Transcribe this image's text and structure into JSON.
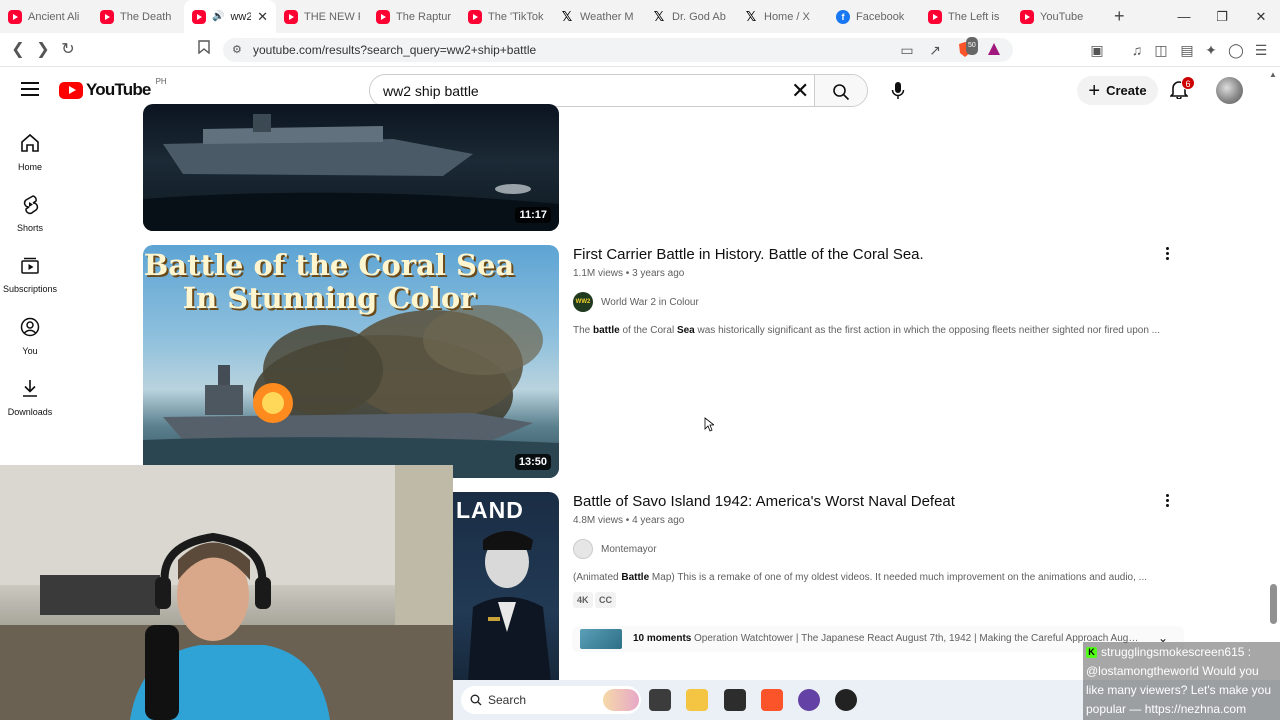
{
  "browser": {
    "tabs": [
      {
        "label": "Ancient Ali",
        "icon": "youtube-icon",
        "active": false
      },
      {
        "label": "The Death",
        "icon": "youtube-icon",
        "active": false
      },
      {
        "label": "ww2",
        "icon": "youtube-icon",
        "active": true
      },
      {
        "label": "THE NEW F",
        "icon": "youtube-icon",
        "active": false
      },
      {
        "label": "The Raptur",
        "icon": "youtube-icon",
        "active": false
      },
      {
        "label": "The 'TikTok",
        "icon": "youtube-icon",
        "active": false
      },
      {
        "label": "Weather M",
        "icon": "x-icon",
        "active": false
      },
      {
        "label": "Dr. God Ab",
        "icon": "x-icon",
        "active": false
      },
      {
        "label": "Home / X",
        "icon": "x-icon",
        "active": false
      },
      {
        "label": "Facebook",
        "icon": "facebook-icon",
        "active": false
      },
      {
        "label": "The Left is",
        "icon": "youtube-icon",
        "active": false
      },
      {
        "label": "YouTube",
        "icon": "youtube-icon",
        "active": false
      }
    ],
    "new_tab": "+",
    "url": "youtube.com/results?search_query=ww2+ship+battle",
    "shield_count": "50"
  },
  "youtube": {
    "logo": "YouTube",
    "country": "PH",
    "search_query": "ww2 ship battle",
    "create_label": "Create",
    "notification_count": "6",
    "nav": [
      {
        "label": "Home",
        "icon": "home-icon"
      },
      {
        "label": "Shorts",
        "icon": "shorts-icon"
      },
      {
        "label": "Subscriptions",
        "icon": "subscriptions-icon"
      },
      {
        "label": "You",
        "icon": "you-icon"
      },
      {
        "label": "Downloads",
        "icon": "downloads-icon"
      }
    ]
  },
  "results": [
    {
      "duration": "11:17"
    },
    {
      "thumb_title_line1": "Battle of the Coral Sea",
      "thumb_title_line2": "In Stunning Color",
      "duration": "13:50",
      "title": "First Carrier Battle in History. Battle of the Coral Sea.",
      "views": "1.1M views",
      "age": "3 years ago",
      "channel": "World War 2 in Colour",
      "channel_avatar_text": "WW2",
      "desc_1": "The ",
      "desc_b1": "battle",
      "desc_2": " of the Coral ",
      "desc_b2": "Sea",
      "desc_3": " was historically significant as the first action in which the opposing fleets neither sighted nor fired upon ..."
    },
    {
      "thumb_title": "LAND",
      "title": "Battle of Savo Island 1942: America's Worst Naval Defeat",
      "views": "4.8M views",
      "age": "4 years ago",
      "channel": "Montemayor",
      "desc_1": "(Animated ",
      "desc_b1": "Battle",
      "desc_2": " Map) This is a remake of one of my oldest videos. It needed much improvement on the animations and audio, ...",
      "badges": [
        "4K",
        "CC"
      ],
      "moments_count": "10 moments",
      "moments_text": "Operation Watchtower | The Japanese React August 7th, 1942 | Making the Careful Approach August ..."
    }
  ],
  "taskbar": {
    "search_label": "Search"
  },
  "chat": {
    "badge": "K",
    "text": "strugglingsmokescreen615 : @lostamongtheworld Would you like many viewers? Let's make you popular — https://nezhna.com"
  },
  "colors": {
    "youtube_red": "#ff0000",
    "notification_badge": "#cc0000",
    "kick_green": "#53fc18"
  }
}
